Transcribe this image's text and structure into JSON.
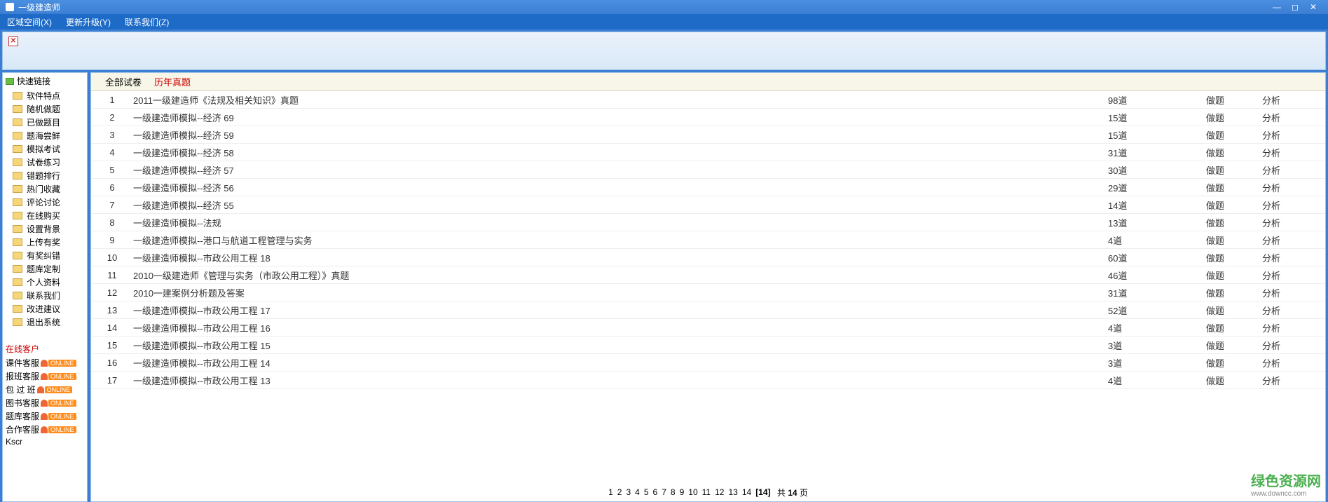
{
  "window": {
    "title": "一级建造师"
  },
  "menu": {
    "area": "区域空间(X)",
    "update": "更新升级(Y)",
    "contact": "联系我们(Z)"
  },
  "sidebar": {
    "header": "快速链接",
    "items": [
      "软件特点",
      "随机做题",
      "已做题目",
      "题海尝鲜",
      "模拟考试",
      "试卷练习",
      "错题排行",
      "热门收藏",
      "评论讨论",
      "在线购买",
      "设置背景",
      "上传有奖",
      "有奖纠错",
      "题库定制",
      "个人资料",
      "联系我们",
      "改进建议",
      "退出系统"
    ],
    "cs_header": "在线客户",
    "cs": [
      "课件客服",
      "报班客服",
      "包 过 班",
      "图书客服",
      "题库客服",
      "合作客服",
      "Kscr"
    ],
    "online_tag": "ONLINE"
  },
  "tabs": {
    "all": "全部试卷",
    "real": "历年真题"
  },
  "columns": {
    "do": "做题",
    "analyze": "分析",
    "unit": "道"
  },
  "rows": [
    {
      "n": 1,
      "t": "2011一级建造师《法规及相关知识》真题",
      "c": 98
    },
    {
      "n": 2,
      "t": "一级建造师模拟--经济 69",
      "c": 15
    },
    {
      "n": 3,
      "t": "一级建造师模拟--经济 59",
      "c": 15
    },
    {
      "n": 4,
      "t": "一级建造师模拟--经济 58",
      "c": 31
    },
    {
      "n": 5,
      "t": "一级建造师模拟--经济 57",
      "c": 30
    },
    {
      "n": 6,
      "t": "一级建造师模拟--经济 56",
      "c": 29
    },
    {
      "n": 7,
      "t": "一级建造师模拟--经济 55",
      "c": 14
    },
    {
      "n": 8,
      "t": "一级建造师模拟--法规",
      "c": 13
    },
    {
      "n": 9,
      "t": "一级建造师模拟--港口与航道工程管理与实务",
      "c": 4
    },
    {
      "n": 10,
      "t": "一级建造师模拟--市政公用工程 18",
      "c": 60
    },
    {
      "n": 11,
      "t": "2010一级建造师《管理与实务（市政公用工程）》真题",
      "c": 46
    },
    {
      "n": 12,
      "t": "2010一建案例分析题及答案",
      "c": 31
    },
    {
      "n": 13,
      "t": "一级建造师模拟--市政公用工程 17",
      "c": 52
    },
    {
      "n": 14,
      "t": "一级建造师模拟--市政公用工程 16",
      "c": 4
    },
    {
      "n": 15,
      "t": "一级建造师模拟--市政公用工程 15",
      "c": 3
    },
    {
      "n": 16,
      "t": "一级建造师模拟--市政公用工程 14",
      "c": 3
    },
    {
      "n": 17,
      "t": "一级建造师模拟--市政公用工程 13",
      "c": 4
    }
  ],
  "pager": {
    "pages": [
      "1",
      "2",
      "3",
      "4",
      "5",
      "6",
      "7",
      "8",
      "9",
      "10",
      "11",
      "12",
      "13",
      "14"
    ],
    "current": "[14]",
    "prefix": "共 ",
    "total": "14",
    "suffix": " 页"
  },
  "watermark": {
    "main": "绿色资源网",
    "sub": "www.downcc.com"
  }
}
